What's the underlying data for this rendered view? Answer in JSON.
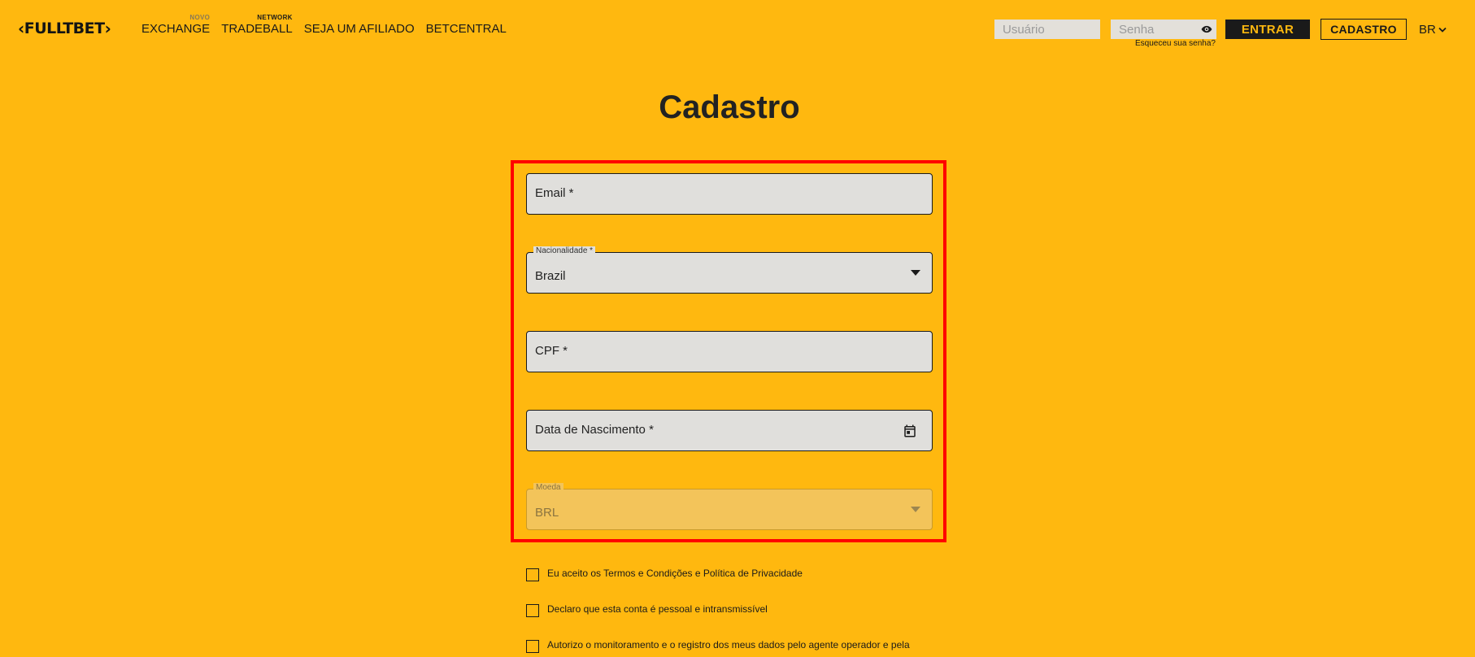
{
  "header": {
    "logo_text": "FULLTBET",
    "nav": [
      {
        "label": "EXCHANGE",
        "sup": "NOVO"
      },
      {
        "label": "TRADEBALL",
        "sup": "NETWORK"
      },
      {
        "label": "SEJA UM AFILIADO",
        "sup": ""
      },
      {
        "label": "BETCENTRAL",
        "sup": ""
      }
    ],
    "username_placeholder": "Usuário",
    "password_placeholder": "Senha",
    "forgot_password": "Esqueceu sua senha?",
    "login_button": "ENTRAR",
    "register_button": "CADASTRO",
    "language": "BR"
  },
  "page": {
    "title": "Cadastro"
  },
  "form": {
    "email_label": "Email *",
    "nationality_label": "Nacionalidade *",
    "nationality_value": "Brazil",
    "cpf_label": "CPF *",
    "birthdate_label": "Data de Nascimento *",
    "currency_label": "Moeda",
    "currency_value": "BRL"
  },
  "checkboxes": [
    {
      "label": "Eu aceito os Termos e Condições e Política de Privacidade"
    },
    {
      "label": "Declaro que esta conta é pessoal e intransmissível"
    },
    {
      "label": "Autorizo o monitoramento e o registro dos meus dados pelo agente operador e pela"
    }
  ],
  "colors": {
    "background": "#ffb80f",
    "highlight_border": "#ff0000",
    "field_bg": "#e0dfdc",
    "dark": "#1a1a1a"
  }
}
